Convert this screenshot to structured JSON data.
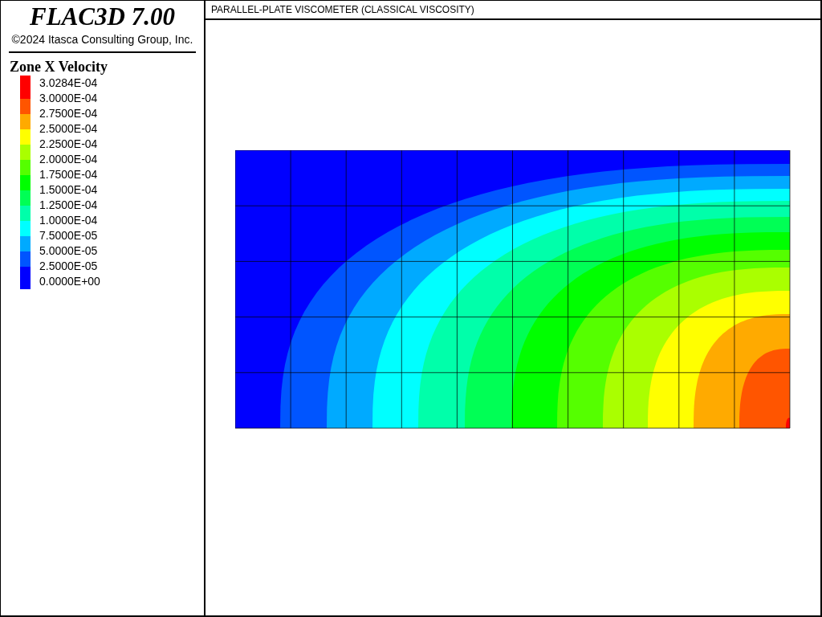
{
  "header": {
    "title": "FLAC3D 7.00",
    "copyright": "©2024 Itasca Consulting Group, Inc."
  },
  "legend": {
    "title": "Zone X Velocity",
    "levels": [
      "3.0284E-04",
      "3.0000E-04",
      "2.7500E-04",
      "2.5000E-04",
      "2.2500E-04",
      "2.0000E-04",
      "1.7500E-04",
      "1.5000E-04",
      "1.2500E-04",
      "1.0000E-04",
      "7.5000E-05",
      "5.0000E-05",
      "2.5000E-05",
      "0.0000E+00"
    ],
    "color_bands": [
      {
        "color": "#ff0000"
      },
      {
        "color": "#ff5500"
      },
      {
        "color": "#ffaa00"
      },
      {
        "color": "#ffff00"
      },
      {
        "color": "#aaff00"
      },
      {
        "color": "#55ff00"
      },
      {
        "color": "#00ff00"
      },
      {
        "color": "#00ff55"
      },
      {
        "color": "#00ffaa"
      },
      {
        "color": "#00ffff"
      },
      {
        "color": "#00aaff"
      },
      {
        "color": "#0055ff"
      },
      {
        "color": "#0000ff"
      }
    ]
  },
  "plot": {
    "title": "PARALLEL-PLATE VISCOMETER (CLASSICAL VISCOSITY)"
  }
}
